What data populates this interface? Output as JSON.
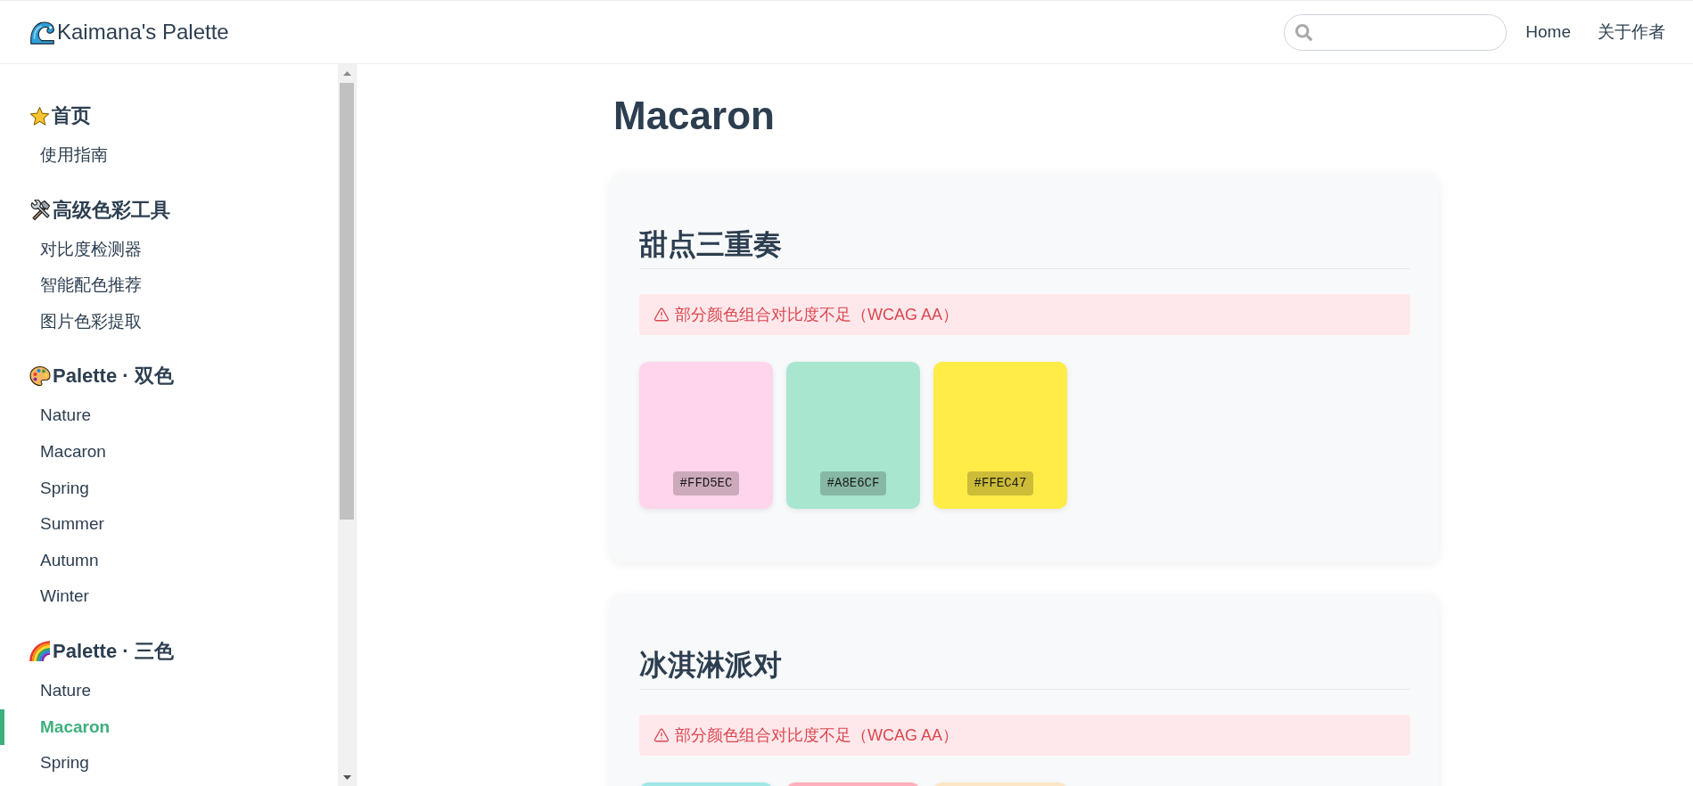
{
  "header": {
    "logo": "Kaimana's Palette",
    "nav": [
      {
        "label": "Home"
      },
      {
        "label": "关于作者"
      }
    ]
  },
  "sidebar": {
    "groups": [
      {
        "title": "首页",
        "items": [
          {
            "label": "使用指南",
            "selected": false
          }
        ]
      },
      {
        "title": "高级色彩工具",
        "items": [
          {
            "label": "对比度检测器",
            "selected": false
          },
          {
            "label": "智能配色推荐",
            "selected": false
          },
          {
            "label": "图片色彩提取",
            "selected": false
          }
        ]
      },
      {
        "title": "Palette · 双色",
        "items": [
          {
            "label": "Nature",
            "selected": false
          },
          {
            "label": "Macaron",
            "selected": false
          },
          {
            "label": "Spring",
            "selected": false
          },
          {
            "label": "Summer",
            "selected": false
          },
          {
            "label": "Autumn",
            "selected": false
          },
          {
            "label": "Winter",
            "selected": false
          }
        ]
      },
      {
        "title": "Palette · 三色",
        "items": [
          {
            "label": "Nature",
            "selected": false
          },
          {
            "label": "Macaron",
            "selected": true
          },
          {
            "label": "Spring",
            "selected": false
          }
        ]
      }
    ]
  },
  "page_title": "Macaron",
  "palettes": [
    {
      "title": "甜点三重奏",
      "warning": "部分颜色组合对比度不足（WCAG AA）",
      "swatches": [
        {
          "hex": "#FFD5EC",
          "color": "#ffd5ec"
        },
        {
          "hex": "#A8E6CF",
          "color": "#a8e6cf"
        },
        {
          "hex": "#FFEC47",
          "color": "#ffec47"
        }
      ]
    },
    {
      "title": "冰淇淋派对",
      "warning": "部分颜色组合对比度不足（WCAG AA）",
      "swatches": [
        {
          "color": "#a0e7e5"
        },
        {
          "color": "#ffaebc"
        },
        {
          "color": "#fbe7c6"
        }
      ]
    }
  ]
}
